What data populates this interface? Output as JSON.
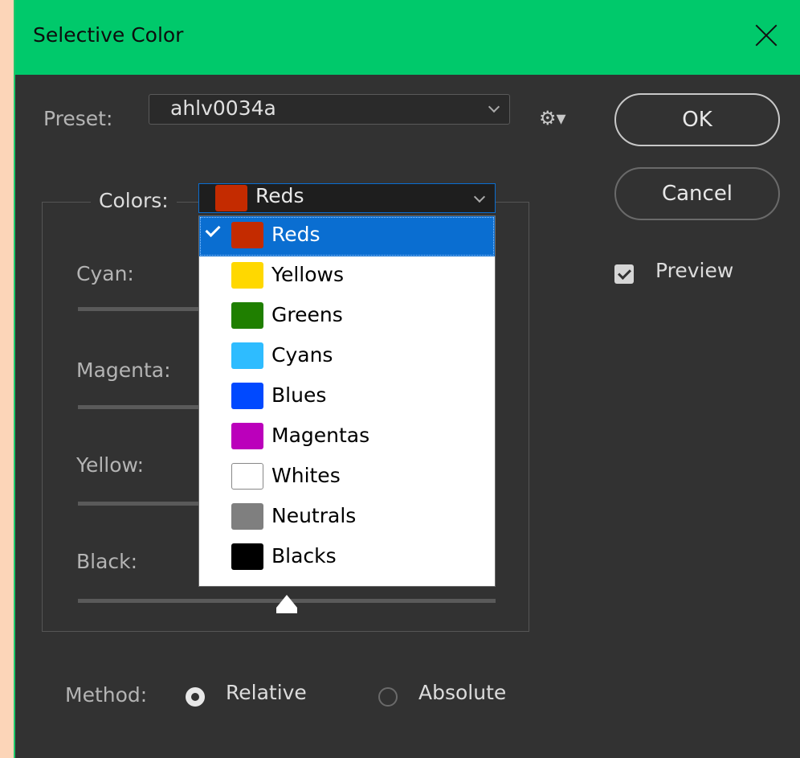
{
  "window": {
    "title": "Selective Color",
    "close_icon": "close-icon"
  },
  "preset": {
    "label": "Preset:",
    "value": "ahlv0034a",
    "settings_icon": "gear-icon"
  },
  "buttons": {
    "ok": "OK",
    "cancel": "Cancel"
  },
  "preview": {
    "label": "Preview",
    "checked": true
  },
  "colors": {
    "label": "Colors:",
    "selected": "Reds",
    "selected_swatch": "#c42b00",
    "options": [
      {
        "label": "Reds",
        "swatch": "#c42b00",
        "selected": true
      },
      {
        "label": "Yellows",
        "swatch": "#ffd800",
        "selected": false
      },
      {
        "label": "Greens",
        "swatch": "#1f7f00",
        "selected": false
      },
      {
        "label": "Cyans",
        "swatch": "#2ebcff",
        "selected": false
      },
      {
        "label": "Blues",
        "swatch": "#0049ff",
        "selected": false
      },
      {
        "label": "Magentas",
        "swatch": "#bb00bb",
        "selected": false
      },
      {
        "label": "Whites",
        "swatch": "#ffffff",
        "selected": false
      },
      {
        "label": "Neutrals",
        "swatch": "#7f7f7f",
        "selected": false
      },
      {
        "label": "Blacks",
        "swatch": "#000000",
        "selected": false
      }
    ]
  },
  "sliders": {
    "cyan": "Cyan:",
    "magenta": "Magenta:",
    "yellow": "Yellow:",
    "black": "Black:",
    "black_level": 0.5
  },
  "method": {
    "label": "Method:",
    "relative": "Relative",
    "absolute": "Absolute",
    "selected": "Relative"
  },
  "colors_theme": {
    "titlebar": "#00c96b",
    "dialog_bg": "#323232",
    "selection": "#0a6ed1"
  }
}
